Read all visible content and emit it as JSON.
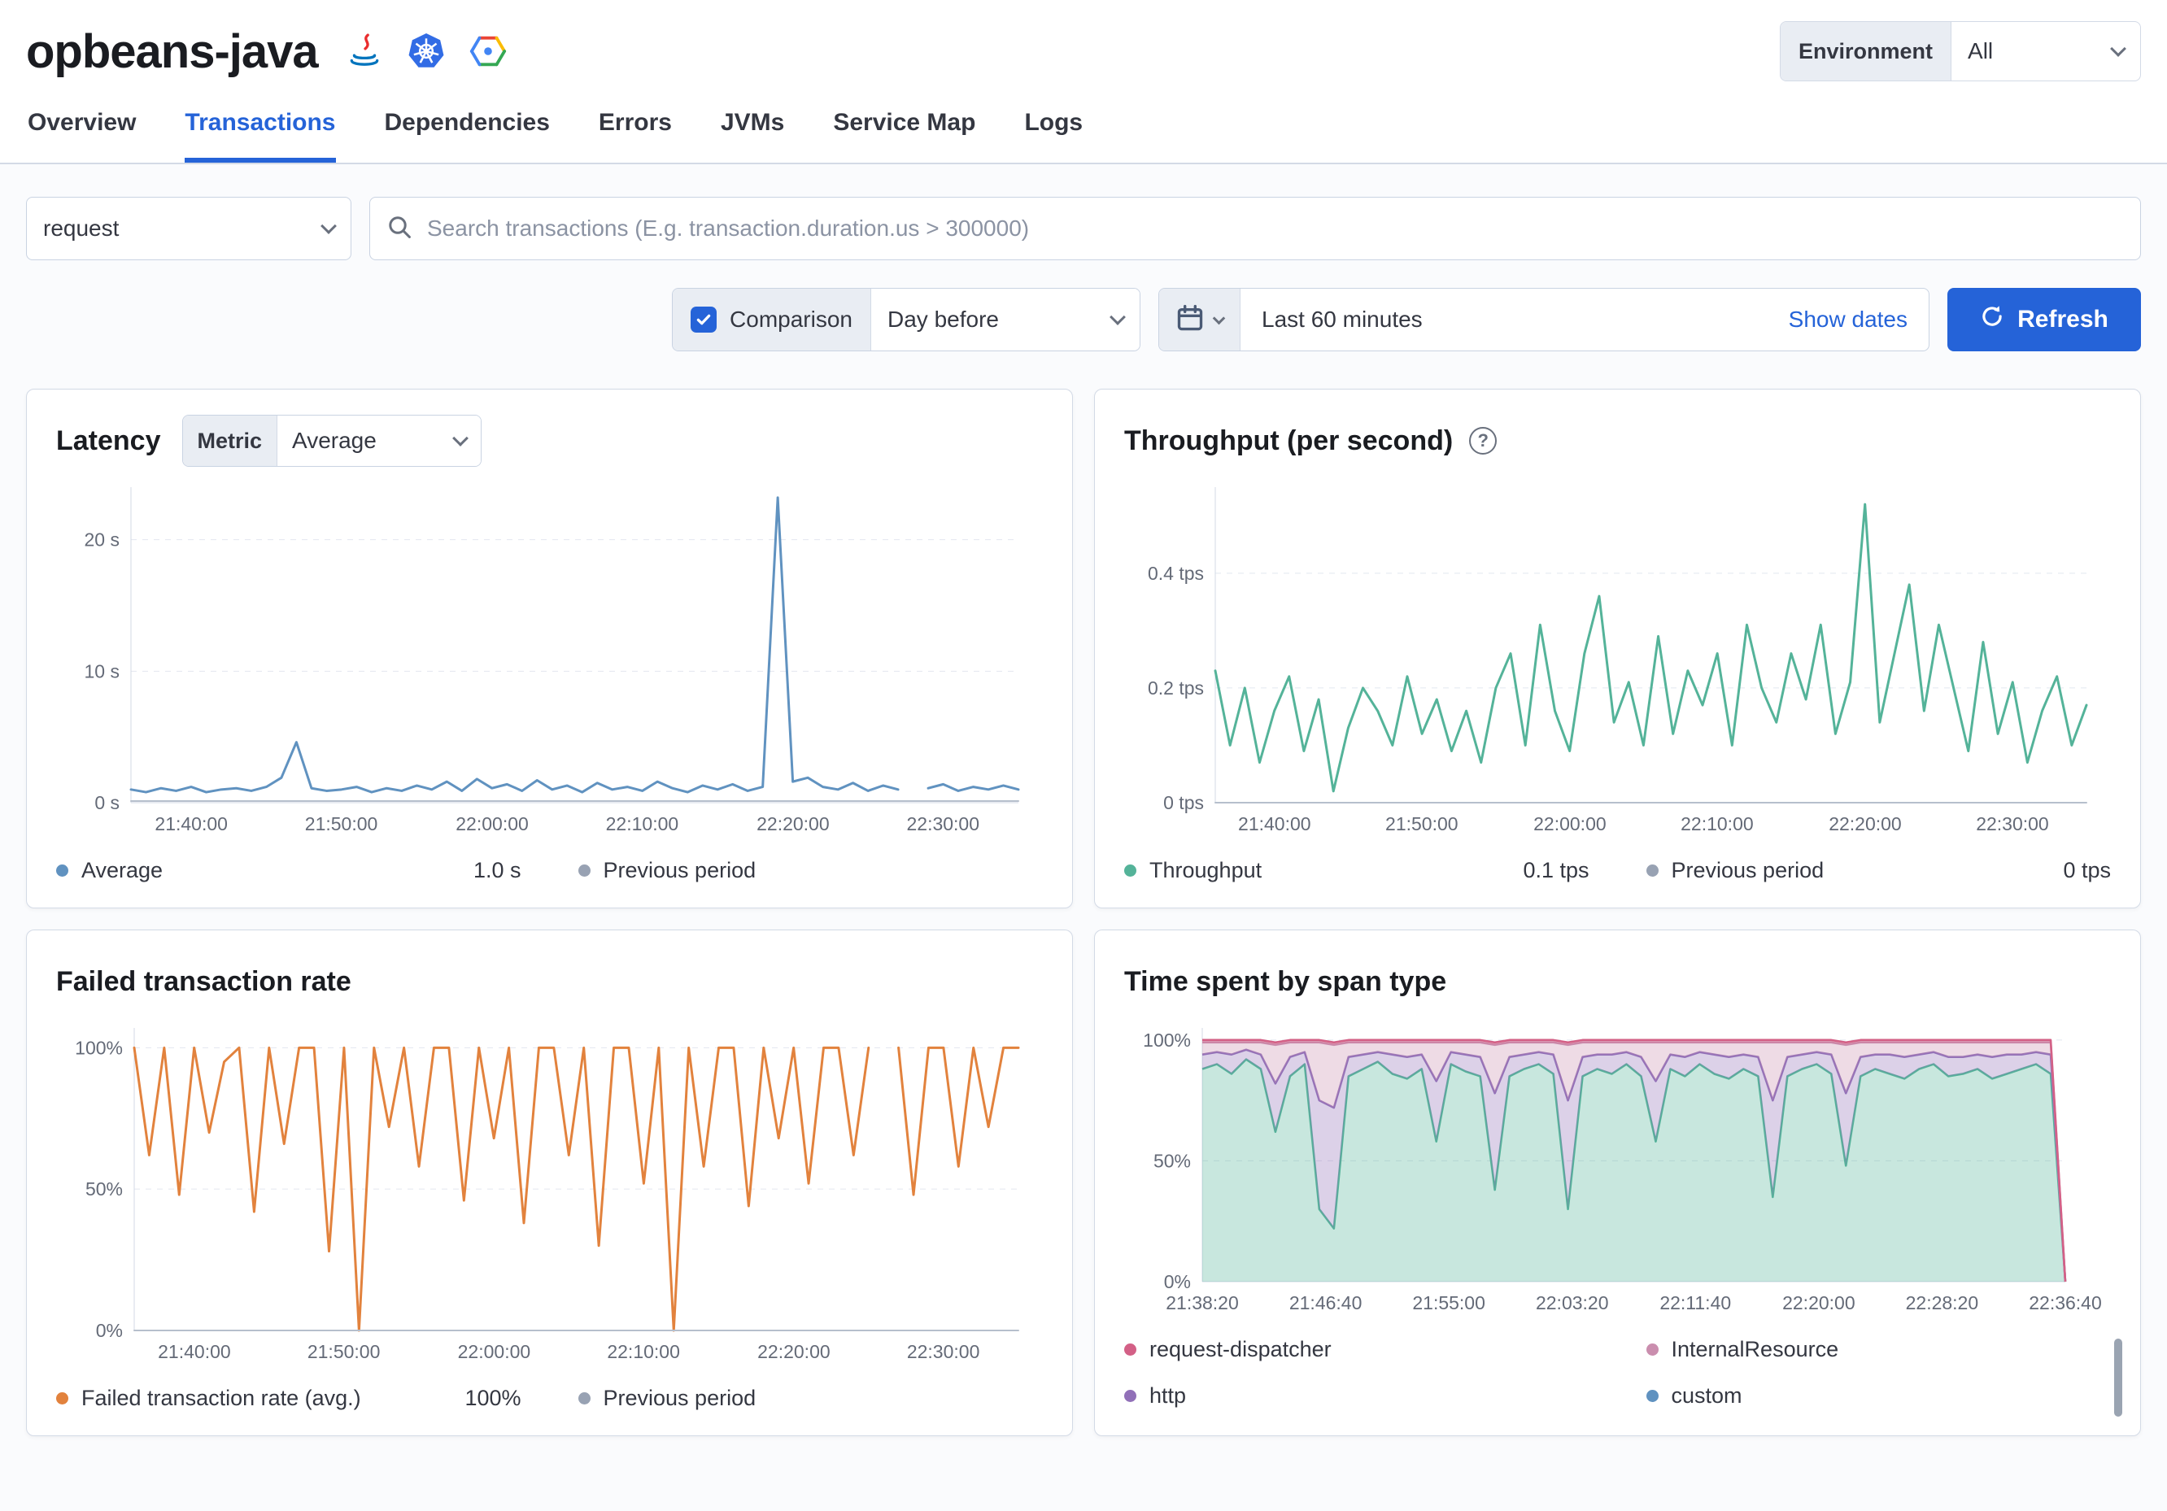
{
  "colors": {
    "accent": "#2563d8",
    "latency": "#6092C0",
    "throughput": "#54B399",
    "failed": "#E2823D",
    "previous": "#98A2B3"
  },
  "header": {
    "title": "opbeans-java",
    "environment_label": "Environment",
    "environment_value": "All"
  },
  "tabs": [
    {
      "label": "Overview"
    },
    {
      "label": "Transactions"
    },
    {
      "label": "Dependencies"
    },
    {
      "label": "Errors"
    },
    {
      "label": "JVMs"
    },
    {
      "label": "Service Map"
    },
    {
      "label": "Logs"
    }
  ],
  "filters": {
    "transaction_type": "request",
    "search_placeholder": "Search transactions (E.g. transaction.duration.us > 300000)"
  },
  "controls": {
    "comparison_label": "Comparison",
    "comparison_option": "Day before",
    "time_range": "Last 60 minutes",
    "show_dates_label": "Show dates",
    "refresh_label": "Refresh"
  },
  "panels": {
    "latency": {
      "title": "Latency",
      "metric_label": "Metric",
      "metric_value": "Average",
      "legend": [
        {
          "label": "Average",
          "value": "1.0 s",
          "color": "#6092C0"
        },
        {
          "label": "Previous period",
          "value": "",
          "color": "#98A2B3"
        }
      ]
    },
    "throughput": {
      "title": "Throughput (per second)",
      "help_icon": "?",
      "legend": [
        {
          "label": "Throughput",
          "value": "0.1 tps",
          "color": "#54B399"
        },
        {
          "label": "Previous period",
          "value": "0 tps",
          "color": "#98A2B3"
        }
      ]
    },
    "failed_rate": {
      "title": "Failed transaction rate",
      "legend": [
        {
          "label": "Failed transaction rate (avg.)",
          "value": "100%",
          "color": "#E2823D"
        },
        {
          "label": "Previous period",
          "value": "",
          "color": "#98A2B3"
        }
      ]
    },
    "span_type": {
      "title": "Time spent by span type",
      "legend": [
        {
          "label": "request-dispatcher",
          "color": "#D36086"
        },
        {
          "label": "InternalResource",
          "color": "#CA8EAE"
        },
        {
          "label": "http",
          "color": "#9170B8"
        },
        {
          "label": "custom",
          "color": "#6092C0"
        }
      ]
    }
  },
  "chart_data": [
    {
      "id": "latency",
      "type": "line",
      "n": 60,
      "ymax": 24,
      "pad_left": 92,
      "title": "Latency",
      "ylabel": "seconds",
      "yticks": [
        {
          "v": 0,
          "label": "0 s"
        },
        {
          "v": 10,
          "label": "10 s"
        },
        {
          "v": 20,
          "label": "20 s"
        }
      ],
      "xticks": [
        "21:40:00",
        "21:50:00",
        "22:00:00",
        "22:10:00",
        "22:20:00",
        "22:30:00"
      ],
      "xtick_pos": [
        0.068,
        0.237,
        0.407,
        0.576,
        0.746,
        0.915
      ],
      "series": [
        {
          "name": "Average",
          "color": "#6092C0",
          "width": 3,
          "values": [
            1.0,
            0.8,
            1.1,
            0.9,
            1.2,
            0.8,
            1.0,
            1.1,
            0.9,
            1.2,
            1.9,
            4.6,
            1.1,
            0.9,
            1.0,
            1.2,
            0.8,
            1.1,
            0.9,
            1.3,
            1.0,
            1.6,
            0.9,
            1.8,
            1.1,
            1.4,
            0.9,
            1.7,
            1.0,
            1.3,
            0.8,
            1.5,
            1.0,
            1.2,
            0.9,
            1.6,
            1.1,
            0.8,
            1.3,
            1.0,
            1.4,
            0.9,
            1.2,
            23.2,
            1.6,
            1.9,
            1.2,
            1.0,
            1.5,
            0.9,
            1.3,
            1.0,
            null,
            1.1,
            1.4,
            0.9,
            1.2,
            1.0,
            1.3,
            1.0
          ]
        },
        {
          "name": "Previous period",
          "color": "#b6bfcc",
          "width": 2,
          "flat": 0.12
        }
      ]
    },
    {
      "id": "throughput",
      "type": "line",
      "n": 60,
      "ymax": 0.55,
      "pad_left": 112,
      "title": "Throughput (per second)",
      "ylabel": "tps",
      "yticks": [
        {
          "v": 0,
          "label": "0 tps"
        },
        {
          "v": 0.2,
          "label": "0.2 tps"
        },
        {
          "v": 0.4,
          "label": "0.4 tps"
        }
      ],
      "xticks": [
        "21:40:00",
        "21:50:00",
        "22:00:00",
        "22:10:00",
        "22:20:00",
        "22:30:00"
      ],
      "xtick_pos": [
        0.068,
        0.237,
        0.407,
        0.576,
        0.746,
        0.915
      ],
      "series": [
        {
          "name": "Throughput",
          "color": "#54B399",
          "width": 3,
          "values": [
            0.23,
            0.1,
            0.2,
            0.07,
            0.16,
            0.22,
            0.09,
            0.18,
            0.02,
            0.13,
            0.2,
            0.16,
            0.1,
            0.22,
            0.12,
            0.18,
            0.09,
            0.16,
            0.07,
            0.2,
            0.26,
            0.1,
            0.31,
            0.16,
            0.09,
            0.26,
            0.36,
            0.14,
            0.21,
            0.1,
            0.29,
            0.12,
            0.23,
            0.17,
            0.26,
            0.1,
            0.31,
            0.2,
            0.14,
            0.26,
            0.18,
            0.31,
            0.12,
            0.21,
            0.52,
            0.14,
            0.26,
            0.38,
            0.16,
            0.31,
            0.2,
            0.09,
            0.28,
            0.12,
            0.21,
            0.07,
            0.16,
            0.22,
            0.1,
            0.17
          ]
        },
        {
          "name": "Previous period",
          "color": "#b6bfcc",
          "width": 2,
          "flat": 0
        }
      ]
    },
    {
      "id": "failed",
      "type": "line",
      "n": 60,
      "ymax": 107,
      "pad_left": 96,
      "title": "Failed transaction rate",
      "ylabel": "%",
      "yticks": [
        {
          "v": 0,
          "label": "0%"
        },
        {
          "v": 50,
          "label": "50%"
        },
        {
          "v": 100,
          "label": "100%"
        }
      ],
      "xticks": [
        "21:40:00",
        "21:50:00",
        "22:00:00",
        "22:10:00",
        "22:20:00",
        "22:30:00"
      ],
      "xtick_pos": [
        0.068,
        0.237,
        0.407,
        0.576,
        0.746,
        0.915
      ],
      "series": [
        {
          "name": "Failed transaction rate (avg.)",
          "color": "#E2823D",
          "width": 3,
          "values": [
            100,
            62,
            100,
            48,
            100,
            70,
            95,
            100,
            42,
            100,
            66,
            100,
            100,
            28,
            100,
            0,
            100,
            72,
            100,
            58,
            100,
            100,
            46,
            100,
            68,
            100,
            38,
            100,
            100,
            62,
            100,
            30,
            100,
            100,
            52,
            100,
            0,
            100,
            58,
            100,
            100,
            44,
            100,
            68,
            100,
            52,
            100,
            100,
            62,
            100,
            null,
            100,
            48,
            100,
            100,
            58,
            100,
            72,
            100,
            100
          ]
        },
        {
          "name": "Previous period",
          "color": "#b6bfcc",
          "width": 2,
          "flat": 0
        }
      ]
    },
    {
      "id": "spantype",
      "type": "stacked_area",
      "n": 60,
      "ymax": 105,
      "pad_left": 96,
      "pad_right": 56,
      "title": "Time spent by span type",
      "ylabel": "%",
      "yticks": [
        {
          "v": 0,
          "label": "0%"
        },
        {
          "v": 50,
          "label": "50%"
        },
        {
          "v": 100,
          "label": "100%"
        }
      ],
      "xticks": [
        "21:38:20",
        "21:46:40",
        "21:55:00",
        "22:03:20",
        "22:11:40",
        "22:20:00",
        "22:28:20",
        "22:36:40"
      ],
      "xtick_pos": [
        0,
        0.1429,
        0.2857,
        0.4286,
        0.5714,
        0.7143,
        0.8571,
        1.0
      ],
      "series": [
        {
          "name": "custom",
          "color": "#54B399",
          "values": [
            88,
            90,
            86,
            92,
            88,
            62,
            85,
            90,
            30,
            22,
            85,
            88,
            91,
            86,
            84,
            88,
            58,
            90,
            87,
            85,
            38,
            85,
            88,
            90,
            86,
            30,
            85,
            88,
            86,
            90,
            85,
            58,
            88,
            85,
            90,
            86,
            84,
            88,
            85,
            35,
            85,
            88,
            90,
            86,
            48,
            85,
            88,
            86,
            84,
            88,
            90,
            85,
            86,
            88,
            84,
            86,
            88,
            90,
            86,
            0
          ]
        },
        {
          "name": "http",
          "color": "#9170B8",
          "values": [
            6,
            5,
            8,
            4,
            6,
            20,
            8,
            5,
            45,
            50,
            8,
            6,
            4,
            8,
            9,
            6,
            25,
            5,
            7,
            8,
            40,
            8,
            6,
            5,
            8,
            45,
            8,
            6,
            8,
            5,
            8,
            25,
            6,
            8,
            5,
            8,
            9,
            6,
            8,
            40,
            8,
            6,
            5,
            8,
            30,
            8,
            6,
            8,
            9,
            6,
            5,
            8,
            7,
            6,
            9,
            8,
            6,
            5,
            8,
            0
          ]
        },
        {
          "name": "InternalResource",
          "color": "#CA8EAE",
          "values": [
            5,
            4,
            5,
            3,
            5,
            16,
            6,
            4,
            24,
            26,
            6,
            5,
            4,
            5,
            6,
            5,
            16,
            4,
            5,
            6,
            20,
            6,
            5,
            4,
            5,
            23,
            6,
            5,
            5,
            4,
            6,
            16,
            5,
            6,
            4,
            5,
            6,
            5,
            6,
            24,
            6,
            5,
            4,
            5,
            20,
            6,
            5,
            5,
            6,
            5,
            4,
            6,
            6,
            5,
            6,
            5,
            5,
            4,
            5,
            0
          ]
        },
        {
          "name": "request-dispatcher",
          "color": "#D36086",
          "values": [
            1,
            1,
            1,
            1,
            1,
            1,
            1,
            1,
            1,
            1,
            1,
            1,
            1,
            1,
            1,
            1,
            1,
            1,
            1,
            1,
            1,
            1,
            1,
            1,
            1,
            1,
            1,
            1,
            1,
            1,
            1,
            1,
            1,
            1,
            1,
            1,
            1,
            1,
            1,
            1,
            1,
            1,
            1,
            1,
            1,
            1,
            1,
            1,
            1,
            1,
            1,
            1,
            1,
            1,
            1,
            1,
            1,
            1,
            1,
            0
          ]
        }
      ]
    }
  ]
}
